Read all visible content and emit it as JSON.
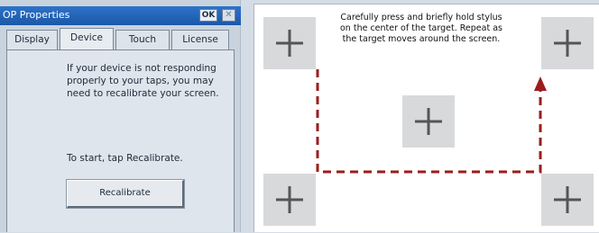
{
  "dialog": {
    "title": "OP Properties",
    "ok_label": "OK",
    "close_glyph": "✕",
    "tabs": [
      {
        "label": "Display"
      },
      {
        "label": "Device"
      },
      {
        "label": "Touch"
      },
      {
        "label": "License"
      }
    ],
    "active_tab": "Device",
    "description": "If your device is not responding properly to your taps, you may need to recalibrate your screen.",
    "start_text": "To start, tap Recalibrate.",
    "recalibrate_label": "Recalibrate"
  },
  "calibration": {
    "instructions": "Carefully press and briefly hold stylus on the center of the target. Repeat as the target moves around the screen.",
    "targets": [
      "top-left",
      "top-right",
      "center",
      "bottom-left",
      "bottom-right"
    ],
    "target_icon": "crosshair-icon",
    "path_color": "#9b1d1d"
  },
  "colors": {
    "titlebar": "#1f5fb3",
    "target_bg": "#d8d9db",
    "crosshair": "#555555"
  }
}
